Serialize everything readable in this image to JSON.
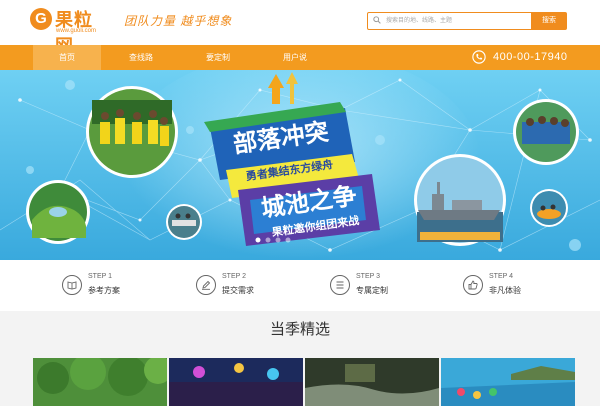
{
  "header": {
    "logo_letter": "G",
    "logo_name": "果粒网",
    "logo_url": "www.guoli.com",
    "slogan": "团队力量  越乎想象"
  },
  "search": {
    "placeholder": "搜索目的地、线路、主题",
    "button_label": "搜索"
  },
  "nav": {
    "items": [
      {
        "label": "首页",
        "active": true
      },
      {
        "label": "查线路"
      },
      {
        "label": "要定制"
      },
      {
        "label": "用户说"
      }
    ],
    "phone_icon": "phone-icon",
    "phone": "400-00-17940"
  },
  "banner": {
    "title_1": "部落冲突",
    "subtitle_1": "勇者集结东方绿舟",
    "title_2": "城池之争",
    "subtitle_2": "果粒邀你组团来战"
  },
  "steps": [
    {
      "num": "STEP 1",
      "name": "参考方案",
      "icon": "book-icon"
    },
    {
      "num": "STEP 2",
      "name": "提交需求",
      "icon": "pencil-icon"
    },
    {
      "num": "STEP 3",
      "name": "专属定制",
      "icon": "list-icon"
    },
    {
      "num": "STEP 4",
      "name": "非凡体验",
      "icon": "thumbs-up-icon"
    }
  ],
  "section": {
    "title": "当季精选"
  },
  "colors": {
    "brand_orange": "#f08c1e",
    "nav_orange": "#f39b1f",
    "banner_sky": "#5cc3ec",
    "banner_blue": "#1f63b8"
  }
}
